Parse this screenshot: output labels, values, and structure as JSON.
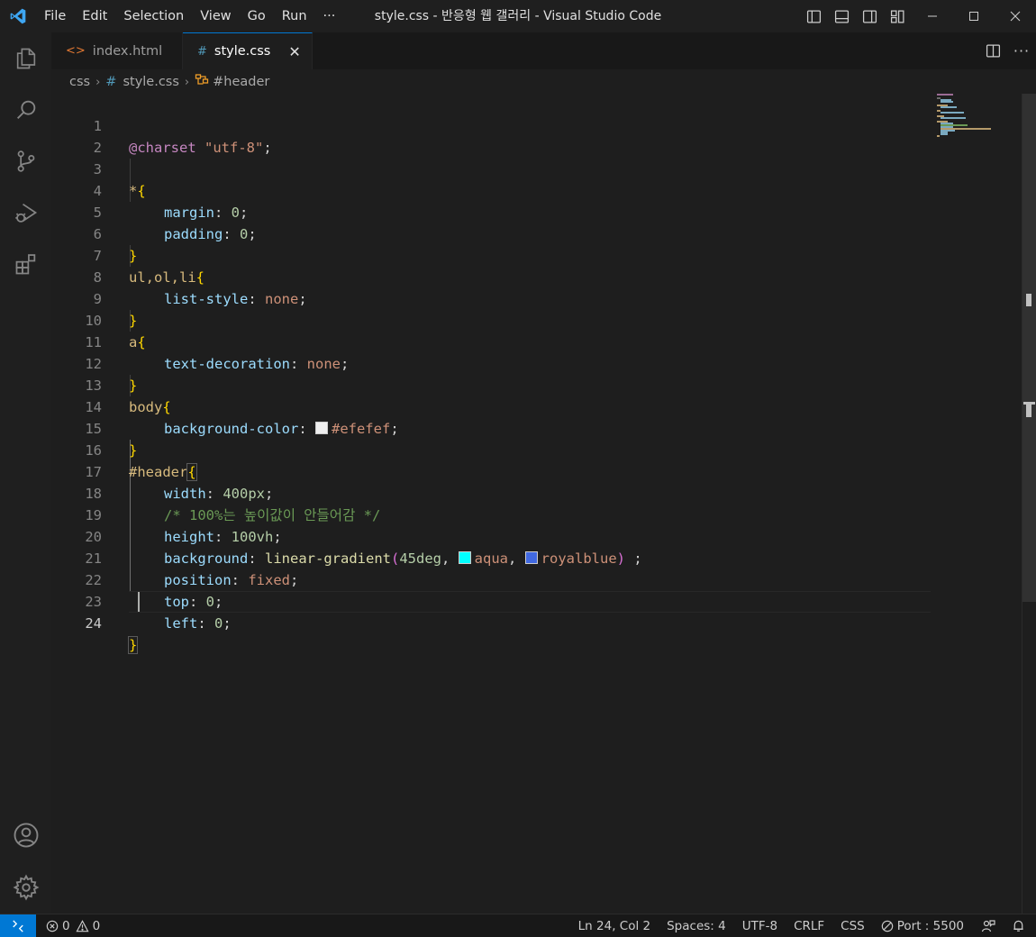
{
  "window": {
    "title": "style.css - 반응형 웹 갤러리 - Visual Studio Code"
  },
  "menu": [
    "File",
    "Edit",
    "Selection",
    "View",
    "Go",
    "Run",
    "···"
  ],
  "activity": [
    "explorer-icon",
    "search-icon",
    "source-control-icon",
    "run-debug-icon",
    "extensions-icon",
    "account-icon",
    "settings-gear-icon"
  ],
  "tabs": [
    {
      "label": "index.html",
      "icon": "<>",
      "icon_color": "#e37933"
    },
    {
      "label": "style.css",
      "icon": "#",
      "icon_color": "#519aba",
      "active": true,
      "close": "✕"
    }
  ],
  "breadcrumb": {
    "folder": "css",
    "file_icon": "#",
    "file": "style.css",
    "symbol": "#header"
  },
  "editor": {
    "line_numbers": [
      "1",
      "2",
      "3",
      "4",
      "5",
      "6",
      "7",
      "8",
      "9",
      "10",
      "11",
      "12",
      "13",
      "14",
      "15",
      "16",
      "17",
      "18",
      "19",
      "20",
      "21",
      "22",
      "23",
      "24"
    ],
    "colors": {
      "efefef": "#efefef",
      "aqua": "#00ffff",
      "royalblue": "#4169e1"
    },
    "l1": {
      "at": "@charset",
      "str": "\"utf-8\"",
      "semi": ";"
    },
    "l3": {
      "sel": "*",
      "open": "{"
    },
    "l4": {
      "prop": "margin",
      "colon": ": ",
      "num": "0",
      "semi": ";"
    },
    "l5": {
      "prop": "padding",
      "colon": ": ",
      "num": "0",
      "semi": ";"
    },
    "l6": {
      "close": "}"
    },
    "l7": {
      "tags": "ul,ol,li",
      "open": "{"
    },
    "l8": {
      "prop": "list-style",
      "colon": ": ",
      "val": "none",
      "semi": ";"
    },
    "l9": {
      "close": "}"
    },
    "l10": {
      "tag": "a",
      "open": "{"
    },
    "l11": {
      "prop": "text-decoration",
      "colon": ": ",
      "val": "none",
      "semi": ";"
    },
    "l12": {
      "close": "}"
    },
    "l13": {
      "tag": "body",
      "open": "{"
    },
    "l14": {
      "prop": "background-color",
      "colon": ": ",
      "val": "#efefef",
      "semi": ";"
    },
    "l15": {
      "close": "}"
    },
    "l16": {
      "sel": "#header",
      "open": "{"
    },
    "l17": {
      "prop": "width",
      "colon": ": ",
      "num": "400px",
      "semi": ";"
    },
    "l18": {
      "comment": "/* 100%는 높이값이 안들어감 */"
    },
    "l19": {
      "prop": "height",
      "colon": ": ",
      "num": "100vh",
      "semi": ";"
    },
    "l20": {
      "prop": "background",
      "colon": ": ",
      "fn": "linear-gradient",
      "paren_open": "(",
      "num": "45deg",
      "comma1": ", ",
      "val1": "aqua",
      "comma2": ", ",
      "val2": "royalblue",
      "paren_close": ")",
      "semi": " ;"
    },
    "l21": {
      "prop": "position",
      "colon": ": ",
      "val": "fixed",
      "semi": ";"
    },
    "l22": {
      "prop": "top",
      "colon": ": ",
      "num": "0",
      "semi": ";"
    },
    "l23": {
      "prop": "left",
      "colon": ": ",
      "num": "0",
      "semi": ";"
    },
    "l24": {
      "close": "}"
    }
  },
  "status": {
    "errors": "0",
    "warnings": "0",
    "position": "Ln 24, Col 2",
    "spaces": "Spaces: 4",
    "encoding": "UTF-8",
    "eol": "CRLF",
    "language": "CSS",
    "port": "Port : 5500"
  }
}
